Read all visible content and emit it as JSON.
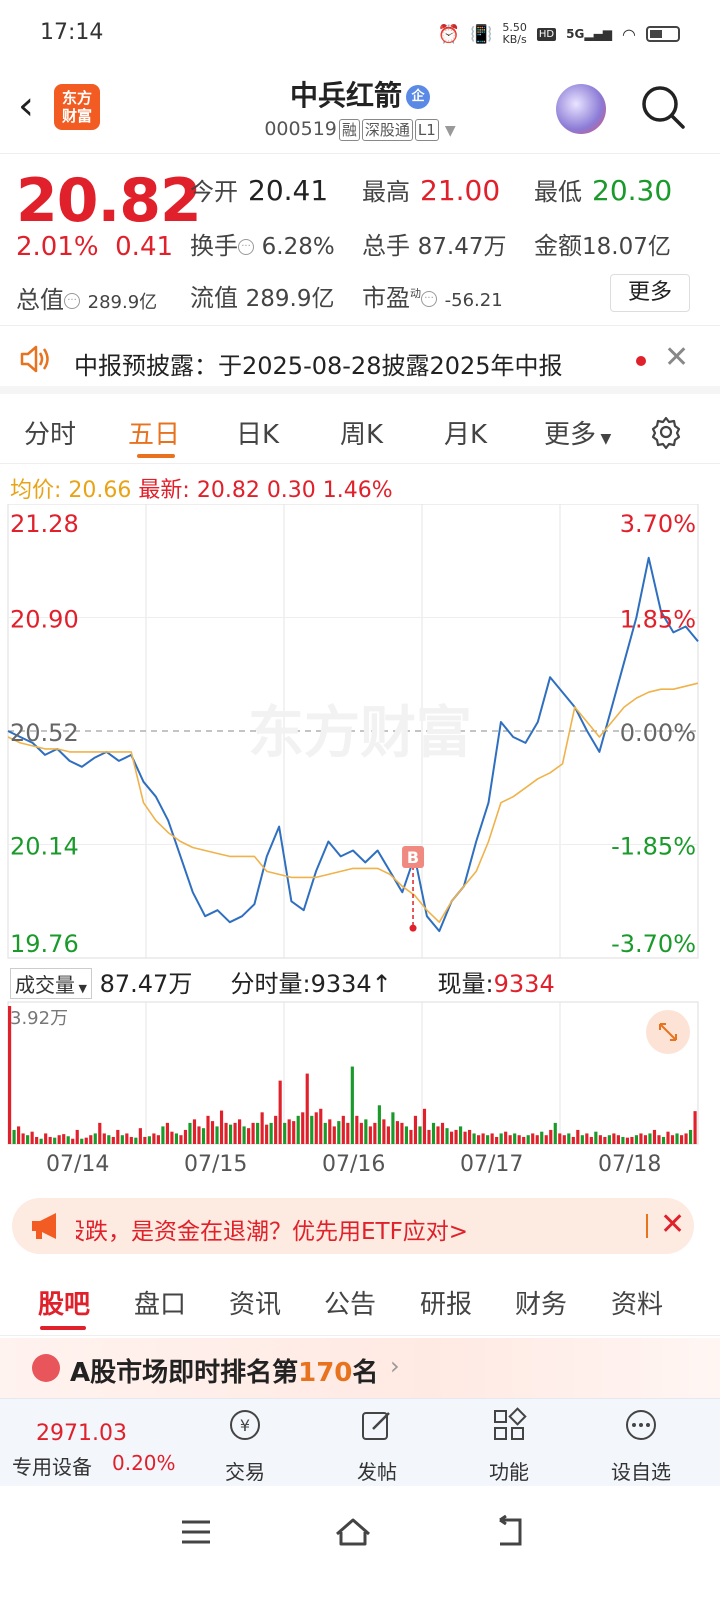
{
  "status_bar": {
    "time": "17:14",
    "net_speed": "5.50",
    "net_unit": "KB/s",
    "hd": "HD",
    "net": "5G"
  },
  "header": {
    "logo_line1": "东方",
    "logo_line2": "财富",
    "stock_name": "中兵红箭",
    "name_badge": "企",
    "stock_code": "000519",
    "tags": [
      "融",
      "深股通",
      "L1"
    ]
  },
  "quote": {
    "price": "20.82",
    "change_pct": "2.01%",
    "change_amt": "0.41",
    "open_label": "今开",
    "open": "20.41",
    "high_label": "最高",
    "high": "21.00",
    "low_label": "最低",
    "low": "20.30",
    "turnover_label": "换手",
    "turnover": "6.28%",
    "volume_label": "总手",
    "volume": "87.47万",
    "amount_label": "金额",
    "amount": "18.07亿",
    "total_cap_label": "总值",
    "total_cap": "289.9亿",
    "float_cap_label": "流值",
    "float_cap": "289.9亿",
    "pe_label": "市盈",
    "pe_sup": "动",
    "pe": "-56.21",
    "more": "更多"
  },
  "notice": {
    "text": "中报预披露：于2025-08-28披露2025年中报"
  },
  "period_tabs": [
    "分时",
    "五日",
    "日K",
    "周K",
    "月K",
    "更多"
  ],
  "chart_header": {
    "avg_label": "均价:",
    "avg": "20.66",
    "latest_label": "最新:",
    "latest": "20.82",
    "latest_chg": "0.30",
    "latest_pct": "1.46%"
  },
  "volume_header": {
    "label": "成交量",
    "total": "87.47万",
    "tick_label": "分时量:",
    "tick": "9334",
    "current_label": "现量:",
    "current": "9334"
  },
  "chart_data": {
    "type": "line",
    "watermark": "东方财富",
    "title": "",
    "x": [
      "07/14",
      "07/15",
      "07/16",
      "07/17",
      "07/18"
    ],
    "y_ticks_left": [
      "21.28",
      "20.90",
      "20.52",
      "20.14",
      "19.76"
    ],
    "y_ticks_right": [
      "3.70%",
      "1.85%",
      "0.00%",
      "-1.85%",
      "-3.70%"
    ],
    "ylim": [
      19.76,
      21.28
    ],
    "prev_close": 20.52,
    "series": [
      {
        "values": [
          20.52,
          20.5,
          20.48,
          20.44,
          20.46,
          20.42,
          20.4,
          20.43,
          20.45,
          20.42,
          20.44,
          20.35,
          20.3,
          20.22,
          20.1,
          19.98,
          19.9,
          19.92,
          19.88,
          19.9,
          19.94,
          20.1,
          20.2,
          19.95,
          19.92,
          20.05,
          20.15,
          20.1,
          20.12,
          20.08,
          20.12,
          20.05,
          19.98,
          20.1,
          19.9,
          19.85,
          19.95,
          20.0,
          20.15,
          20.28,
          20.55,
          20.5,
          20.48,
          20.55,
          20.7,
          20.65,
          20.6,
          20.52,
          20.45,
          20.6,
          20.75,
          20.9,
          21.1,
          20.92,
          20.85,
          20.87,
          20.82
        ]
      },
      {
        "values": [
          20.5,
          20.48,
          20.47,
          20.46,
          20.46,
          20.45,
          20.45,
          20.45,
          20.45,
          20.45,
          20.45,
          20.28,
          20.22,
          20.18,
          20.15,
          20.13,
          20.12,
          20.11,
          20.1,
          20.1,
          20.1,
          20.05,
          20.04,
          20.03,
          20.03,
          20.03,
          20.04,
          20.05,
          20.06,
          20.06,
          20.06,
          20.04,
          20.0,
          19.97,
          19.92,
          19.88,
          19.95,
          20.0,
          20.05,
          20.15,
          20.28,
          20.3,
          20.33,
          20.36,
          20.38,
          20.41,
          20.6,
          20.55,
          20.5,
          20.55,
          20.6,
          20.63,
          20.65,
          20.66,
          20.66,
          20.67,
          20.68
        ]
      }
    ],
    "volume": {
      "ymax_label": "3.92万",
      "ymax": 39200,
      "values": [
        39200,
        4000,
        5000,
        3000,
        2500,
        3500,
        2000,
        1500,
        3000,
        2000,
        1800,
        2500,
        2800,
        2200,
        1500,
        4000,
        1500,
        1800,
        2500,
        3000,
        6000,
        3000,
        2500,
        2000,
        4000,
        2500,
        3000,
        2000,
        1800,
        4500,
        2000,
        2200,
        3000,
        2500,
        5000,
        6000,
        3500,
        3000,
        2500,
        4000,
        6000,
        7000,
        5000,
        4500,
        8000,
        6500,
        5000,
        9500,
        6000,
        5500,
        6000,
        7000,
        5000,
        4500,
        6000,
        6000,
        9000,
        5500,
        6000,
        8000,
        18000,
        6000,
        7000,
        6500,
        8000,
        9000,
        20000,
        8000,
        9000,
        10000,
        6000,
        7000,
        5000,
        6500,
        8000,
        6000,
        22000,
        8000,
        6000,
        7000,
        5000,
        6000,
        11000,
        7000,
        5000,
        9000,
        6500,
        6000,
        5000,
        4000,
        8000,
        5000,
        10000,
        4000,
        6000,
        5000,
        6000,
        4500,
        3500,
        4000,
        5000,
        3500,
        4000,
        3000,
        2500,
        3000,
        2500,
        3000,
        2000,
        3000,
        3500,
        2500,
        3000,
        2500,
        2000,
        2500,
        3000,
        2500,
        3500,
        2500,
        4000,
        6000,
        3000,
        2500,
        3000,
        2000,
        4000,
        2500,
        3000,
        2000,
        3500,
        2500,
        2000,
        2500,
        3000,
        2500,
        2000,
        1800,
        2000,
        2500,
        3000,
        2500,
        3000,
        4000,
        2500,
        2000,
        3500,
        2500,
        3000,
        2500,
        3000,
        4000,
        9334
      ],
      "colors": {
        "up": "#e0202a",
        "down": "#1a9a2a"
      }
    }
  },
  "ad_banner": {
    "text": "股跌，是资金在退潮？优先用ETF应对>"
  },
  "section_tabs": [
    "股吧",
    "盘口",
    "资讯",
    "公告",
    "研报",
    "财务",
    "资料"
  ],
  "ranking": {
    "prefix": "A股市场即时排名第",
    "rank": "170",
    "suffix": "名"
  },
  "bottom_bar": {
    "index_value": "2971.03",
    "index_name": "专用设备",
    "index_pct": "0.20%",
    "items": [
      "交易",
      "发帖",
      "功能",
      "设自选"
    ]
  },
  "colors": {
    "up": "#e0202a",
    "down": "#1a9a2a",
    "accent": "#e8731f",
    "line": "#2f6fc0",
    "avg": "#f0b24a"
  }
}
